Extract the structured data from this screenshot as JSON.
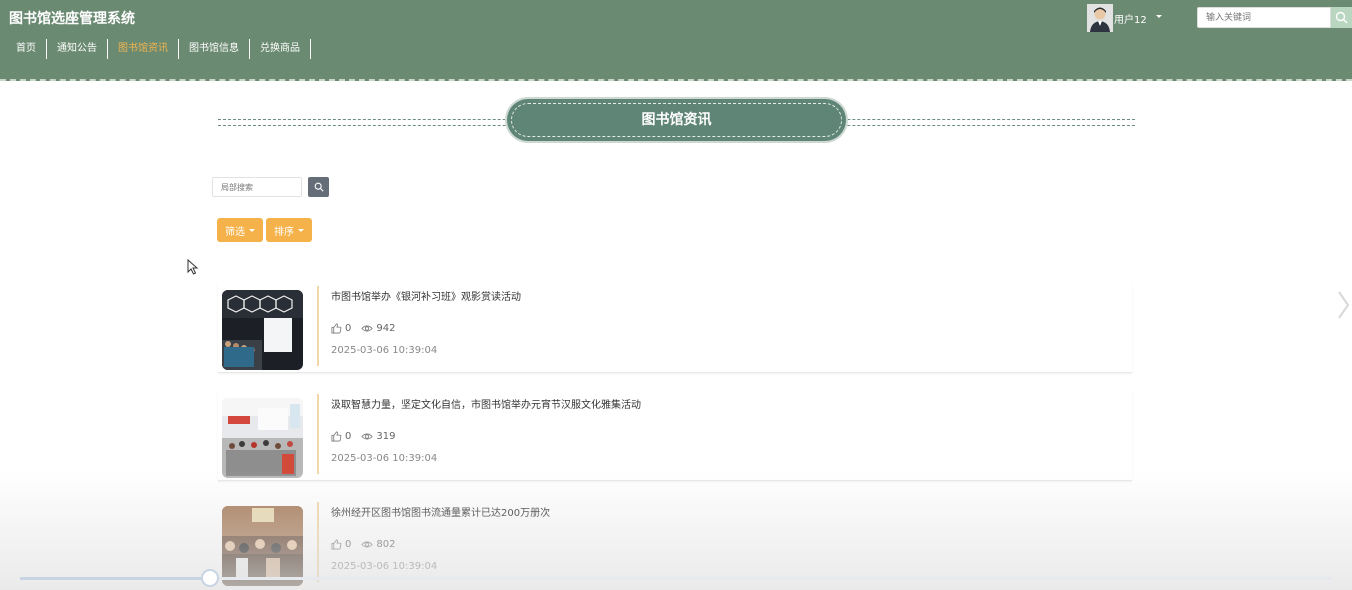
{
  "app": {
    "title": "图书馆选座管理系统"
  },
  "nav": {
    "items": [
      {
        "label": "首页",
        "active": false
      },
      {
        "label": "通知公告",
        "active": false
      },
      {
        "label": "图书馆资讯",
        "active": true
      },
      {
        "label": "图书馆信息",
        "active": false
      },
      {
        "label": "兑换商品",
        "active": false
      }
    ]
  },
  "user": {
    "name": "用户12"
  },
  "header_search": {
    "placeholder": "输入关键词"
  },
  "section": {
    "title": "图书馆资讯"
  },
  "local_search": {
    "placeholder": "局部搜索"
  },
  "filters": {
    "filter_label": "筛选",
    "sort_label": "排序"
  },
  "news": [
    {
      "title": "市图书馆举办《银河补习班》观影赏读活动",
      "likes": "0",
      "views": "942",
      "date": "2025-03-06 10:39:04"
    },
    {
      "title": "汲取智慧力量，坚定文化自信，市图书馆举办元宵节汉服文化雅集活动",
      "likes": "0",
      "views": "319",
      "date": "2025-03-06 10:39:04"
    },
    {
      "title": "徐州经开区图书馆图书流通量累计已达200万册次",
      "likes": "0",
      "views": "802",
      "date": "2025-03-06 10:39:04"
    }
  ],
  "video_progress": 0.145,
  "colors": {
    "header_bg": "#6b8a72",
    "nav_active": "#f0b54f",
    "title_pill": "#5f8577",
    "filter_btn": "#f5b24a",
    "search_btn": "#656e78"
  }
}
